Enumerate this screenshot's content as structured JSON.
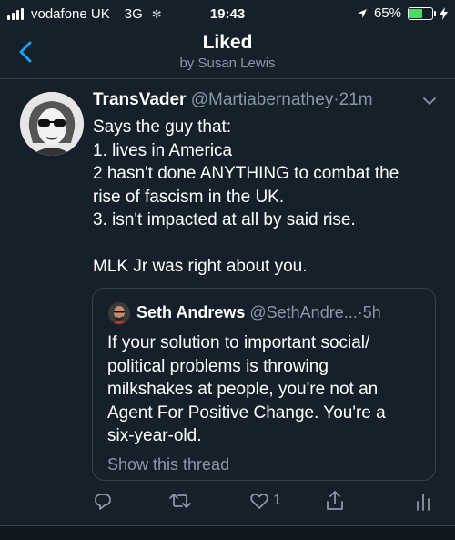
{
  "status_bar": {
    "carrier": "vodafone UK",
    "network": "3G",
    "time": "19:43",
    "battery": "65%",
    "battery_level": 0.65
  },
  "header": {
    "title": "Liked",
    "subtitle": "by Susan Lewis"
  },
  "tweet": {
    "name": "TransVader",
    "handle": "@Martiabernathey",
    "separator": "·",
    "time": "21m",
    "lines": [
      "Says the guy that:",
      "1. lives in America",
      "2 hasn't done ANYTHING to combat the",
      "rise of fascism in the UK.",
      "3. isn't impacted at all by said rise.",
      "",
      "MLK Jr was right about you."
    ]
  },
  "quote": {
    "name": "Seth Andrews",
    "handle": "@SethAndre...",
    "separator": "·",
    "time": "5h",
    "lines": [
      "If your solution to important social/",
      "political problems is throwing",
      "milkshakes at people, you're not an",
      "Agent For Positive Change. You're a",
      "six-year-old."
    ],
    "show_thread": "Show this thread"
  },
  "actions": {
    "like_count": "1"
  },
  "colors": {
    "background": "#15202b",
    "accent": "#1da1f2",
    "muted": "#8899a6",
    "border": "#38444d"
  }
}
